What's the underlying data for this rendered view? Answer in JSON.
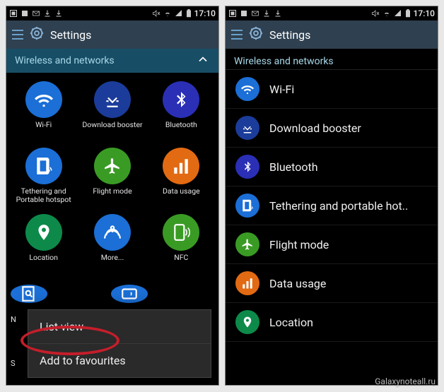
{
  "status": {
    "time": "17:10"
  },
  "header": {
    "title": "Settings"
  },
  "left": {
    "section": "Wireless and networks",
    "items": [
      {
        "label": "Wi-Fi",
        "icon": "wifi",
        "color": "#1b6fd6"
      },
      {
        "label": "Download booster",
        "icon": "download",
        "color": "#1b3c9a"
      },
      {
        "label": "Bluetooth",
        "icon": "bluetooth",
        "color": "#2a2fb6"
      },
      {
        "label": "Tethering and Portable hotspot",
        "icon": "tethering",
        "color": "#1b6fd6"
      },
      {
        "label": "Flight mode",
        "icon": "airplane",
        "color": "#3a9b24"
      },
      {
        "label": "Data usage",
        "icon": "bars",
        "color": "#e26a12"
      },
      {
        "label": "Location",
        "icon": "location",
        "color": "#0d8a4a"
      },
      {
        "label": "More...",
        "icon": "more",
        "color": "#1b6fd6"
      },
      {
        "label": "NFC",
        "icon": "nfc",
        "color": "#3a9b24"
      }
    ],
    "edge_n": "N",
    "edge_s": "S",
    "menu": {
      "item1": "List view",
      "item2": "Add to favourites"
    }
  },
  "right": {
    "section": "Wireless and networks",
    "items": [
      {
        "label": "Wi-Fi",
        "icon": "wifi",
        "color": "#1b6fd6"
      },
      {
        "label": "Download booster",
        "icon": "download",
        "color": "#1b3c9a"
      },
      {
        "label": "Bluetooth",
        "icon": "bluetooth",
        "color": "#2a2fb6"
      },
      {
        "label": "Tethering and portable hot..",
        "icon": "tethering",
        "color": "#1b6fd6"
      },
      {
        "label": "Flight mode",
        "icon": "airplane",
        "color": "#3a9b24"
      },
      {
        "label": "Data usage",
        "icon": "bars",
        "color": "#e26a12"
      },
      {
        "label": "Location",
        "icon": "location",
        "color": "#0d8a4a"
      }
    ]
  },
  "watermark": "Galaxynoteall.ru"
}
